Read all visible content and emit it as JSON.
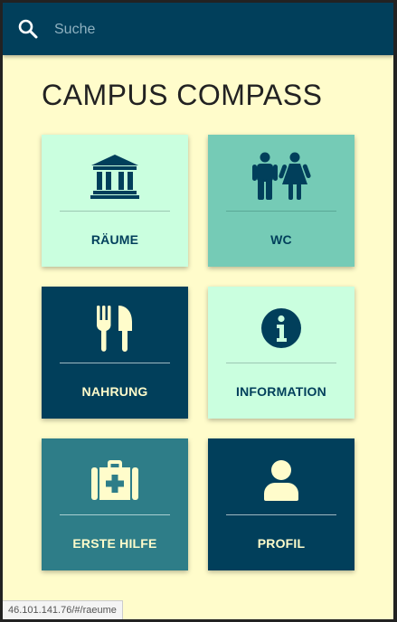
{
  "search": {
    "placeholder": "Suche",
    "icon": "search-icon"
  },
  "page": {
    "title": "CAMPUS COMPASS"
  },
  "tiles": [
    {
      "label": "RÄUME",
      "icon": "building-icon",
      "color": "#caffdf"
    },
    {
      "label": "WC",
      "icon": "restroom-icon",
      "color": "#75cbb6"
    },
    {
      "label": "NAHRUNG",
      "icon": "fork-knife-icon",
      "color": "#013f5b"
    },
    {
      "label": "INFORMATION",
      "icon": "info-icon",
      "color": "#caffdf"
    },
    {
      "label": "ERSTE HILFE",
      "icon": "first-aid-kit-icon",
      "color": "#2e7d88"
    },
    {
      "label": "PROFIL",
      "icon": "user-icon",
      "color": "#013f5b"
    }
  ],
  "status": {
    "url": "46.101.141.76/#/raeume"
  },
  "colors": {
    "header": "#013f5b",
    "background": "#fffccb",
    "icon_light": "#fffccb",
    "icon_dark": "#013f5b"
  }
}
